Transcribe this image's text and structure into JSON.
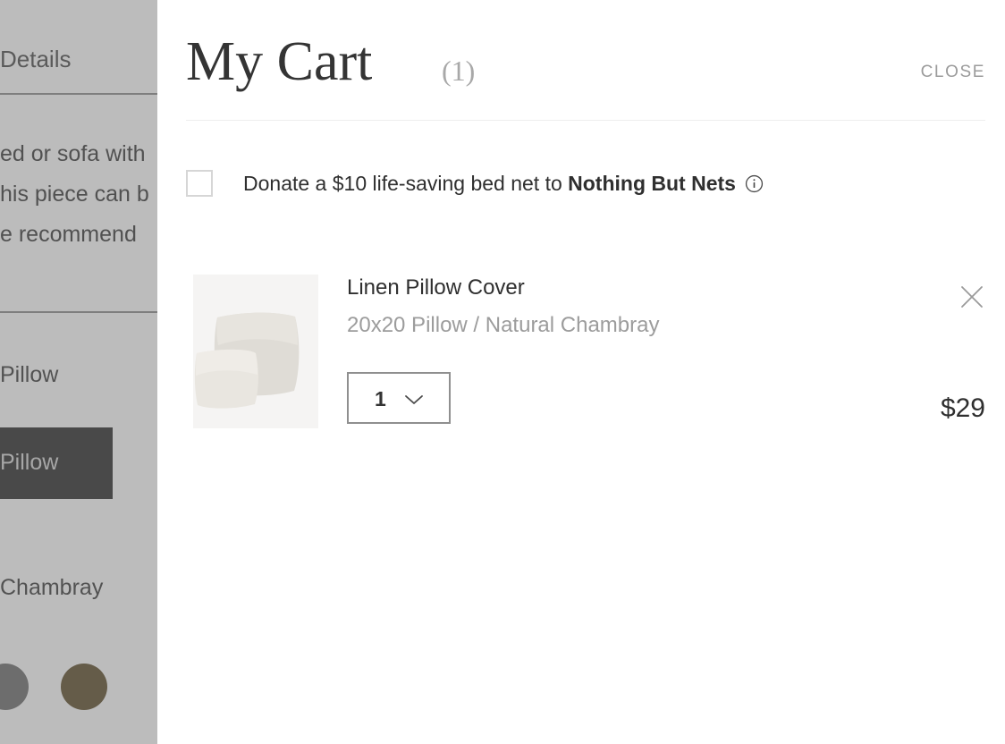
{
  "background_page": {
    "tab_label": "Details",
    "description_lines": [
      "ed or sofa with",
      "his piece can b",
      "e recommend"
    ],
    "option_label_partial": "Pillow",
    "option_selected_partial": "Pillow",
    "color_label_partial": "Chambray",
    "swatches": [
      {
        "name": "gray-swatch",
        "color": "#6e6e6e"
      },
      {
        "name": "brown-swatch",
        "color": "#5f4e2b"
      }
    ],
    "scrim_color": "#b2b2b2"
  },
  "drawer": {
    "title": "My Cart",
    "item_count": "(1)",
    "close_label": "CLOSE",
    "donate": {
      "text_before": "Donate a $10 life-saving bed net to ",
      "charity": "Nothing But Nets",
      "checked": false,
      "info_tooltip_icon": "info-icon"
    },
    "items": [
      {
        "title": "Linen Pillow Cover",
        "variant": "20x20 Pillow / Natural Chambray",
        "quantity": "1",
        "price": "$29",
        "thumb_bg": "#f5f4f3",
        "remove_icon": "close-x-icon"
      }
    ]
  },
  "colors": {
    "title_text": "#343434",
    "muted_text": "#9c9c9c",
    "body_text": "#2f2f2f",
    "border": "#8f8f8f",
    "divider": "#ededed",
    "checkbox_border": "#d6d6d6"
  }
}
